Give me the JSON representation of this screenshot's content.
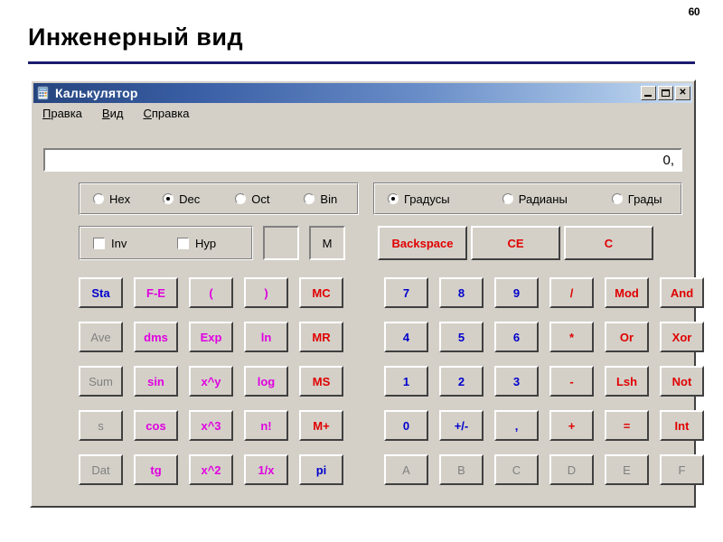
{
  "slide": {
    "title": "Инженерный вид",
    "page_number": "60",
    "rule_color": "#1b1b6f"
  },
  "window": {
    "title": "Калькулятор",
    "icon": "calculator-icon",
    "controls": [
      {
        "name": "minimize",
        "label": "_"
      },
      {
        "name": "maximize",
        "label": "□"
      },
      {
        "name": "close",
        "label": "✕"
      }
    ]
  },
  "menu": [
    {
      "label": "Правка",
      "mnemonic": "П",
      "rest": "равка"
    },
    {
      "label": "Вид",
      "mnemonic": "В",
      "rest": "ид"
    },
    {
      "label": "Справка",
      "mnemonic": "С",
      "rest": "правка"
    }
  ],
  "display": {
    "value": "0,"
  },
  "base_group": {
    "options": [
      {
        "label": "Hex",
        "selected": false
      },
      {
        "label": "Dec",
        "selected": true
      },
      {
        "label": "Oct",
        "selected": false
      },
      {
        "label": "Bin",
        "selected": false
      }
    ]
  },
  "angle_group": {
    "options": [
      {
        "label": "Градусы",
        "selected": true
      },
      {
        "label": "Радианы",
        "selected": false
      },
      {
        "label": "Грады",
        "selected": false
      }
    ]
  },
  "mode_group": {
    "options": [
      {
        "label": "Inv",
        "checked": false
      },
      {
        "label": "Hyp",
        "checked": false
      }
    ]
  },
  "indicators": {
    "paren": "",
    "memory": "M"
  },
  "edit_buttons": [
    {
      "label": "Backspace",
      "color": "red"
    },
    {
      "label": "CE",
      "color": "red"
    },
    {
      "label": "C",
      "color": "red"
    }
  ],
  "keypad": {
    "stat_column": [
      {
        "label": "Sta",
        "color": "blue",
        "disabled": false
      },
      {
        "label": "Ave",
        "color": "dim",
        "disabled": true
      },
      {
        "label": "Sum",
        "color": "dim",
        "disabled": true
      },
      {
        "label": "s",
        "color": "dim",
        "disabled": true
      },
      {
        "label": "Dat",
        "color": "dim",
        "disabled": true
      }
    ],
    "func_column_1": [
      {
        "label": "F-E",
        "color": "magenta"
      },
      {
        "label": "dms",
        "color": "magenta"
      },
      {
        "label": "sin",
        "color": "magenta"
      },
      {
        "label": "cos",
        "color": "magenta"
      },
      {
        "label": "tg",
        "color": "magenta"
      }
    ],
    "func_column_2": [
      {
        "label": "(",
        "color": "magenta"
      },
      {
        "label": "Exp",
        "color": "magenta"
      },
      {
        "label": "x^y",
        "color": "magenta"
      },
      {
        "label": "x^3",
        "color": "magenta"
      },
      {
        "label": "x^2",
        "color": "magenta"
      }
    ],
    "func_column_3": [
      {
        "label": ")",
        "color": "magenta"
      },
      {
        "label": "ln",
        "color": "magenta"
      },
      {
        "label": "log",
        "color": "magenta"
      },
      {
        "label": "n!",
        "color": "magenta"
      },
      {
        "label": "1/x",
        "color": "magenta"
      }
    ],
    "memory_column": [
      {
        "label": "MC",
        "color": "red"
      },
      {
        "label": "MR",
        "color": "red"
      },
      {
        "label": "MS",
        "color": "red"
      },
      {
        "label": "M+",
        "color": "red"
      },
      {
        "label": "pi",
        "color": "blue"
      }
    ],
    "digit_rows": [
      [
        {
          "label": "7",
          "color": "blue"
        },
        {
          "label": "8",
          "color": "blue"
        },
        {
          "label": "9",
          "color": "blue"
        },
        {
          "label": "/",
          "color": "red"
        },
        {
          "label": "Mod",
          "color": "red"
        },
        {
          "label": "And",
          "color": "red"
        }
      ],
      [
        {
          "label": "4",
          "color": "blue"
        },
        {
          "label": "5",
          "color": "blue"
        },
        {
          "label": "6",
          "color": "blue"
        },
        {
          "label": "*",
          "color": "red"
        },
        {
          "label": "Or",
          "color": "red"
        },
        {
          "label": "Xor",
          "color": "red"
        }
      ],
      [
        {
          "label": "1",
          "color": "blue"
        },
        {
          "label": "2",
          "color": "blue"
        },
        {
          "label": "3",
          "color": "blue"
        },
        {
          "label": "-",
          "color": "red"
        },
        {
          "label": "Lsh",
          "color": "red"
        },
        {
          "label": "Not",
          "color": "red"
        }
      ],
      [
        {
          "label": "0",
          "color": "blue"
        },
        {
          "label": "+/-",
          "color": "blue"
        },
        {
          "label": ",",
          "color": "blue"
        },
        {
          "label": "+",
          "color": "red"
        },
        {
          "label": "=",
          "color": "red"
        },
        {
          "label": "Int",
          "color": "red"
        }
      ],
      [
        {
          "label": "A",
          "color": "dim",
          "disabled": true
        },
        {
          "label": "B",
          "color": "dim",
          "disabled": true
        },
        {
          "label": "C",
          "color": "dim",
          "disabled": true
        },
        {
          "label": "D",
          "color": "dim",
          "disabled": true
        },
        {
          "label": "E",
          "color": "dim",
          "disabled": true
        },
        {
          "label": "F",
          "color": "dim",
          "disabled": true
        }
      ]
    ]
  }
}
